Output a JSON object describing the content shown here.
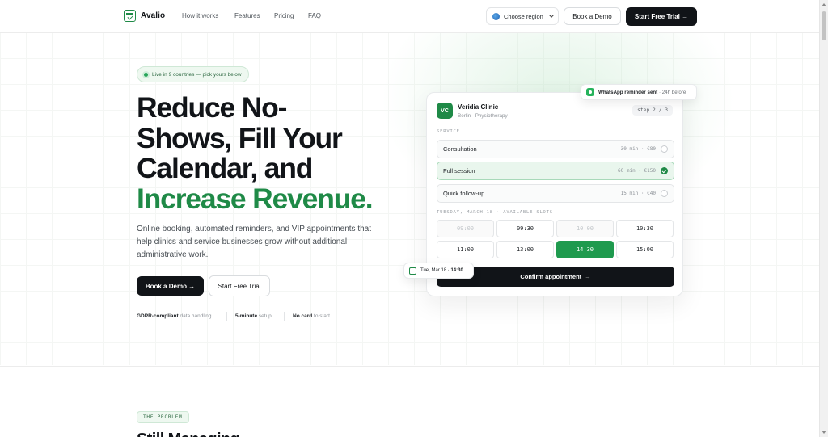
{
  "brand": {
    "name": "Avalio",
    "accent": "#1f8a47",
    "dark": "#111418"
  },
  "nav": {
    "links": [
      "How it works",
      "Features",
      "Pricing",
      "FAQ"
    ],
    "region_label": "Choose region",
    "book_demo": "Book a Demo",
    "start_trial": "Start Free Trial →"
  },
  "hero": {
    "pill": "Live in 9 countries — pick yours below",
    "title_line1": "Reduce No-",
    "title_line2": "Shows, Fill Your",
    "title_line3": "Calendar, and",
    "title_highlight": "Increase Revenue.",
    "subtitle": "Online booking, automated reminders, and VIP appointments that help clinics and service businesses grow without additional administrative work.",
    "cta_primary": "Book a Demo →",
    "cta_secondary": "Start Free Trial",
    "features": [
      {
        "bold": "GDPR-compliant",
        "rest": " data handling"
      },
      {
        "bold": "5-minute",
        "rest": " setup"
      },
      {
        "bold": "No card",
        "rest": " to start"
      }
    ]
  },
  "booking": {
    "initials": "VC",
    "clinic_name": "Veridia Clinic",
    "clinic_sub": "Berlin · Physiotherapy",
    "step": "step 2 / 3",
    "service_label": "SERVICE",
    "services": [
      {
        "name": "Consultation",
        "price": "30 min · €80",
        "selected": false
      },
      {
        "name": "Full session",
        "price": "60 min · €150",
        "selected": true
      },
      {
        "name": "Quick follow-up",
        "price": "15 min · €40",
        "selected": false
      }
    ],
    "slots_label": "TUESDAY, MARCH 18 · AVAILABLE SLOTS",
    "slots": [
      {
        "time": "09:00",
        "state": "disabled"
      },
      {
        "time": "09:30",
        "state": "available"
      },
      {
        "time": "10:00",
        "state": "disabled"
      },
      {
        "time": "10:30",
        "state": "available"
      },
      {
        "time": "11:00",
        "state": "available"
      },
      {
        "time": "13:00",
        "state": "available"
      },
      {
        "time": "14:30",
        "state": "selected"
      },
      {
        "time": "15:00",
        "state": "available"
      }
    ],
    "confirm": "Confirm appointment",
    "confirm_arrow": "→"
  },
  "whatsapp_toast": {
    "bold": "WhatsApp reminder sent",
    "rest": " · 24h before"
  },
  "date_chip": {
    "date": "Tue, Mar 18 · ",
    "time": "14:30"
  },
  "problem_section": {
    "tag": "THE PROBLEM",
    "heading_cut": "Still Managing"
  }
}
